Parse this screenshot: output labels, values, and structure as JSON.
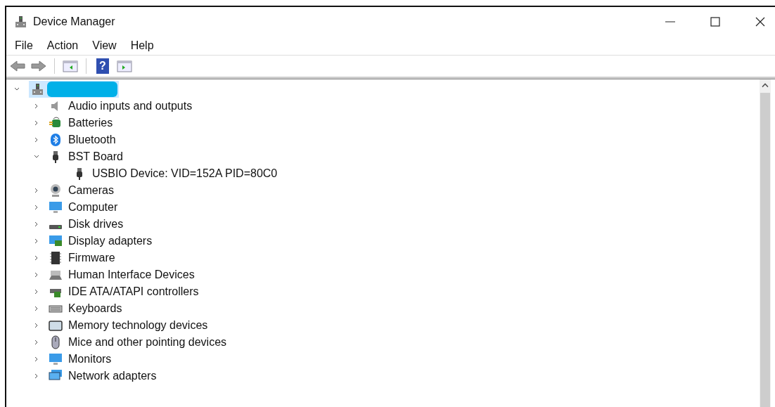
{
  "window": {
    "title": "Device Manager"
  },
  "menu": [
    "File",
    "Action",
    "View",
    "Help"
  ],
  "toolbar": {
    "help_glyph": "?"
  },
  "tree": {
    "kind": "computer",
    "selected": true,
    "expanded": true,
    "redacted": true,
    "children": [
      {
        "label": "Audio inputs and outputs",
        "kind": "speaker",
        "expanded": false
      },
      {
        "label": "Batteries",
        "kind": "battery",
        "expanded": false
      },
      {
        "label": "Bluetooth",
        "kind": "bluetooth",
        "expanded": false
      },
      {
        "label": "BST Board",
        "kind": "usb",
        "expanded": true,
        "children": [
          {
            "label": "USBIO Device: VID=152A PID=80C0",
            "kind": "usb"
          }
        ]
      },
      {
        "label": "Cameras",
        "kind": "camera",
        "expanded": false
      },
      {
        "label": "Computer",
        "kind": "monitor",
        "expanded": false
      },
      {
        "label": "Disk drives",
        "kind": "disk",
        "expanded": false
      },
      {
        "label": "Display adapters",
        "kind": "display",
        "expanded": false
      },
      {
        "label": "Firmware",
        "kind": "chip",
        "expanded": false
      },
      {
        "label": "Human Interface Devices",
        "kind": "hid",
        "expanded": false
      },
      {
        "label": "IDE ATA/ATAPI controllers",
        "kind": "ide",
        "expanded": false
      },
      {
        "label": "Keyboards",
        "kind": "keyboard",
        "expanded": false
      },
      {
        "label": "Memory technology devices",
        "kind": "memory",
        "expanded": false
      },
      {
        "label": "Mice and other pointing devices",
        "kind": "mouse",
        "expanded": false
      },
      {
        "label": "Monitors",
        "kind": "monitor",
        "expanded": false
      },
      {
        "label": "Network adapters",
        "kind": "network",
        "expanded": false
      }
    ]
  }
}
